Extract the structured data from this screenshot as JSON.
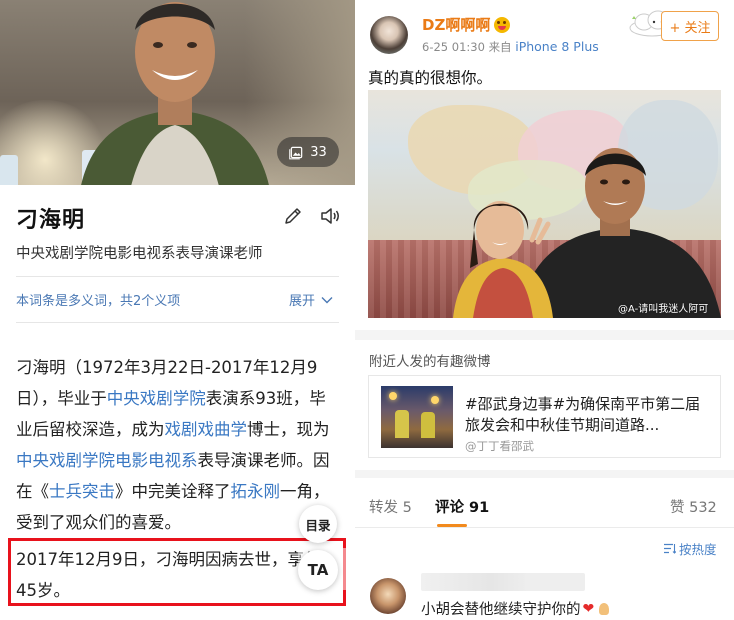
{
  "baike": {
    "photo_count": "33",
    "title": "刁海明",
    "subtitle": "中央戏剧学院电影电视系表导演课老师",
    "polysemy_note": "本词条是多义词，共2个义项",
    "expand_label": "展开",
    "paragraph": {
      "t1": "刁海明（1972年3月22日-2017年12月9日），毕业于",
      "l1": "中央戏剧学院",
      "t2": "表演系93班，毕业后留校深造，成为",
      "l2": "戏剧戏曲学",
      "t3": "博士，现为",
      "l3": "中央戏剧学院电影电视系",
      "t4": "表导演课老师。因在《",
      "l4": "士兵突击",
      "t5": "》中完美诠释了",
      "l5": "拓永刚",
      "t6": "一角，受到了观众们的喜爱。"
    },
    "highlight_text": "2017年12月9日，刁海明因病去世，享年45岁。",
    "toc_button": "目录",
    "ta_button": "TA",
    "highlight_color": "#e8121c"
  },
  "weibo": {
    "username": "DZ啊啊啊",
    "time": "6-25 01:30",
    "source_prefix": "来自",
    "source_device": "iPhone 8 Plus",
    "follow_label": "+ 关注",
    "post_text": "真的真的很想你。",
    "image_watermark": "@A-请叫我迷人阿可",
    "nearby_title": "附近人发的有趣微博",
    "rec_text": "#邵武身边事#为确保南平市第二届旅发会和中秋佳节期间道路...",
    "rec_source": "@丁丁看邵武",
    "tabs": [
      {
        "label": "转发 5"
      },
      {
        "label": "评论 91"
      },
      {
        "label": "赞 532"
      }
    ],
    "sort_label": "按热度",
    "comment_text": "小胡会替他继续守护你的",
    "accent_color": "#ea7b16",
    "link_color": "#4a82c7"
  }
}
